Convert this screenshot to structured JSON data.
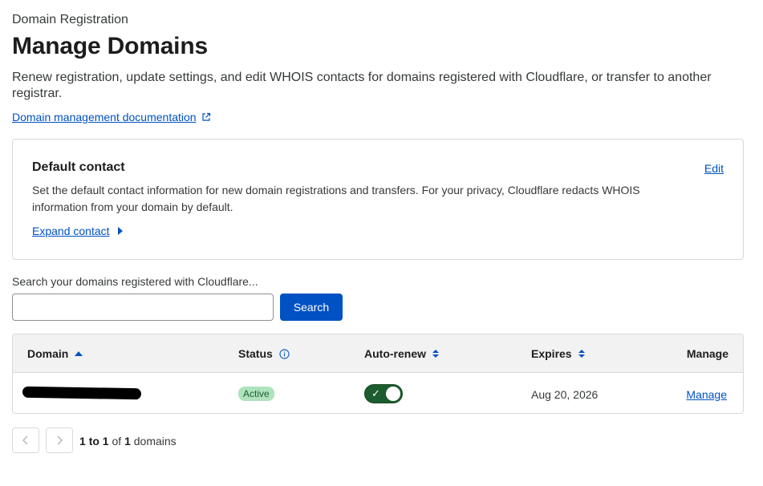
{
  "header": {
    "eyebrow": "Domain Registration",
    "title": "Manage Domains",
    "description": "Renew registration, update settings, and edit WHOIS contacts for domains registered with Cloudflare, or transfer to another registrar.",
    "doc_link": "Domain management documentation"
  },
  "default_contact": {
    "title": "Default contact",
    "edit_label": "Edit",
    "description": "Set the default contact information for new domain registrations and transfers. For your privacy, Cloudflare redacts WHOIS information from your domain by default.",
    "expand_label": "Expand contact"
  },
  "search": {
    "label": "Search your domains registered with Cloudflare...",
    "value": "",
    "placeholder": "",
    "button_label": "Search"
  },
  "table": {
    "columns": {
      "domain": "Domain",
      "status": "Status",
      "auto_renew": "Auto-renew",
      "expires": "Expires",
      "manage": "Manage"
    },
    "rows": [
      {
        "domain": "",
        "status": "Active",
        "auto_renew": true,
        "expires": "Aug 20, 2026",
        "manage": "Manage"
      }
    ]
  },
  "pagination": {
    "prev_icon": "chevron-left-icon",
    "next_icon": "chevron-right-icon",
    "from": "1",
    "to_word": "to",
    "to": "1",
    "of_word": "of",
    "total": "1",
    "unit": "domains"
  },
  "colors": {
    "accent": "#0051c3",
    "toggle_on": "#1d5c2e",
    "badge_active": "#aee3be"
  }
}
